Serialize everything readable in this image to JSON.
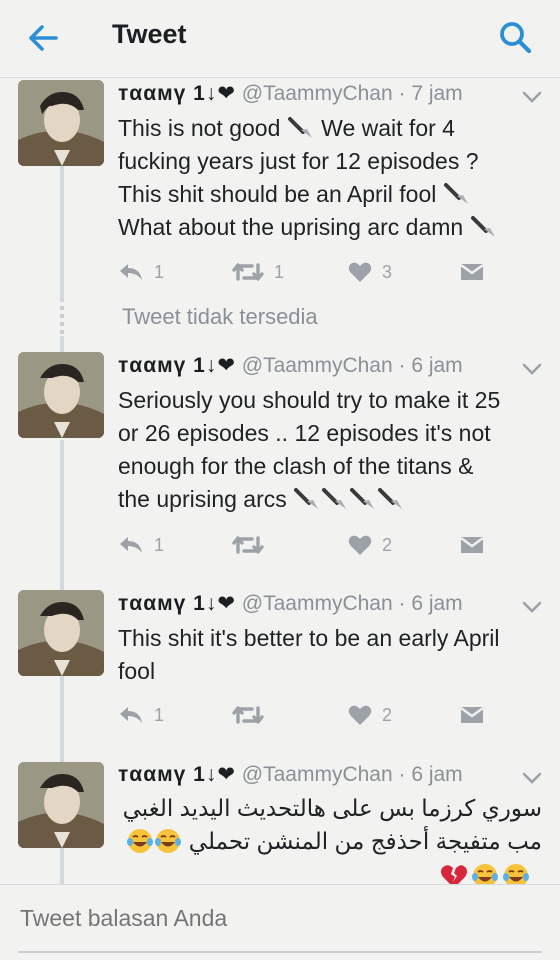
{
  "header": {
    "title": "Tweet",
    "back_icon": "arrow-left-icon",
    "search_icon": "search-icon"
  },
  "colors": {
    "accent": "#2b8fd6",
    "meta": "#8a9096",
    "heart": "#9ca2a7"
  },
  "unavailable_text": "Tweet tidak tersedia",
  "tweets": [
    {
      "name": "тααмү 1↓❤",
      "handle": "@TaammyChan",
      "time": "· 7 jam",
      "lines": [
        "This is not good",
        "We wait for 4",
        "fucking years just for 12 episodes ?",
        "This shit should be an April fool",
        "What about the uprising arc damn"
      ],
      "replies": "1",
      "retweets": "1",
      "likes": "3"
    },
    {
      "name": "тααмү 1↓❤",
      "handle": "@TaammyChan",
      "time": "· 6 jam",
      "lines": [
        "Seriously you should try to make it 25",
        "or 26 episodes .. 12 episodes it's not",
        "enough for the clash of the titans &",
        "the  uprising arcs"
      ],
      "replies": "1",
      "retweets": "",
      "likes": "2"
    },
    {
      "name": "тααмү 1↓❤",
      "handle": "@TaammyChan",
      "time": "· 6 jam",
      "lines": [
        "This shit it's better to be an early April",
        "fool"
      ],
      "replies": "1",
      "retweets": "",
      "likes": "2"
    },
    {
      "name": "тααмү 1↓❤",
      "handle": "@TaammyChan",
      "time": "· 6 jam",
      "lines": [
        "سوري كرزما بس على هالتحديث اليديد الغبي",
        "مب متفيجة أحذفج من المنشن تحملي"
      ],
      "emoji_line1": [
        "face-with-tears-of-joy",
        "face-with-tears-of-joy"
      ],
      "emoji_line2": [
        "broken-heart",
        "face-with-tears-of-joy",
        "face-with-tears-of-joy"
      ]
    }
  ],
  "reply_box": {
    "placeholder": "Tweet balasan Anda"
  }
}
